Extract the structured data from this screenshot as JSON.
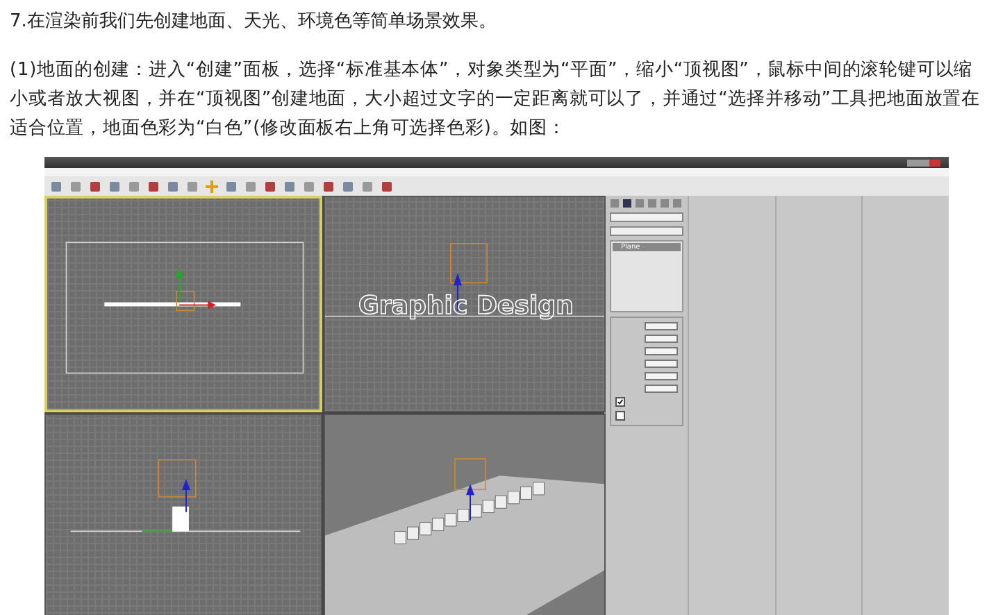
{
  "heading": "7.在渲染前我们先创建地面、天光、环境色等简单场景效果。",
  "paragraph": "(1)地面的创建：进入“创建”面板，选择“标准基本体”，对象类型为“平面”，缩小“顶视图”，鼠标中间的滚轮键可以缩小或者放大视图，并在“顶视图”创建地面，大小超过文字的一定距离就可以了，并通过“选择并移动”工具把地面放置在适合位置，地面色彩为“白色”(修改面板右上角可选择色彩)。如图：",
  "screenshot": {
    "viewports": [
      {
        "kind": "top",
        "active": true
      },
      {
        "kind": "front",
        "active": false
      },
      {
        "kind": "left",
        "active": false
      },
      {
        "kind": "perspective",
        "active": false
      }
    ],
    "text_object": "Graphic Design",
    "modifier_stack": {
      "item": "Plane"
    },
    "checkboxes": [
      {
        "checked": true
      },
      {
        "checked": false
      }
    ]
  }
}
